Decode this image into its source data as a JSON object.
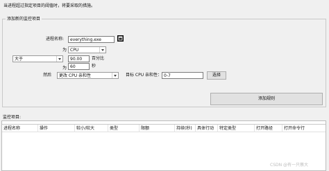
{
  "header": {
    "hint": "当进程超过指定项目的阈值时，将要采取的措施。"
  },
  "add_group": {
    "title": "添加新的监控项目",
    "process_name_label": "进程名称:",
    "process_name_value": "everything.exe",
    "wei_label_1": "为",
    "metric_value": "CPU",
    "comparator_value": "大于",
    "threshold_value": "90.00",
    "threshold_unit": "百分比",
    "wei_label_2": "为",
    "duration_value": "60",
    "duration_unit": "秒",
    "then_label": "然后",
    "action_value": "更改 CPU 亲和性",
    "target_label": "目标 CPU 亲和性：",
    "target_value": "0-7",
    "choose_button": "选择",
    "add_rule_button": "添加规则"
  },
  "monitor": {
    "title": "监控项目:",
    "columns": [
      "进程名称",
      "操作",
      "较小/较大",
      "类型",
      "限额",
      "持续(秒)",
      "具体行动",
      "特定类型",
      "打开路径",
      "打开命令行"
    ]
  },
  "watermark": "CSDN @有一只蔡大"
}
